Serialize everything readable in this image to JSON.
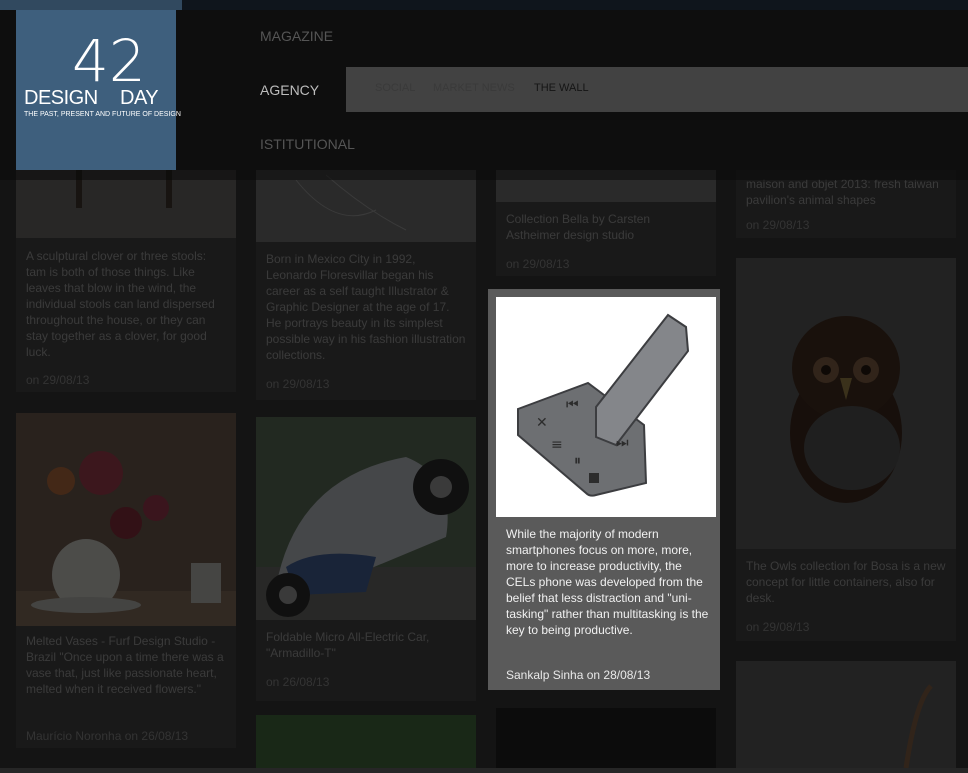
{
  "logo": {
    "word_left": "DESIGN",
    "number": "42",
    "word_right": "DAY",
    "tagline": "THE PAST, PRESENT AND FUTURE OF DESIGN"
  },
  "nav": {
    "items": [
      {
        "label": "MAGAZINE"
      },
      {
        "label": "AGENCY"
      },
      {
        "label": "ISTITUTIONAL"
      }
    ],
    "active": "AGENCY"
  },
  "subnav": {
    "links": [
      {
        "label": "SOCIAL"
      },
      {
        "label": "MARKET NEWS"
      },
      {
        "label": "THE WALL"
      }
    ],
    "active": "THE WALL"
  },
  "cards": {
    "c1": {
      "text": "A sculptural clover or three stools: tam is both of those things. Like leaves that blow in the wind, the individual stools can land dispersed throughout the house, or they can stay together as a clover, for good luck.",
      "meta": "on 29/08/13"
    },
    "c2": {
      "text": "Born in Mexico City in 1992, Leonardo Floresvillar began his career as a self taught Illustrator & Graphic Designer at the age of 17. He portrays beauty in its simplest possible way in his fashion illustration collections.",
      "meta": "on 29/08/13"
    },
    "c3": {
      "text": "Collection Bella by Carsten Astheimer design studio",
      "meta": "on 29/08/13"
    },
    "c4": {
      "text": "maison and objet 2013: fresh taiwan pavilion's animal shapes",
      "meta": "on 29/08/13"
    },
    "c5": {
      "text": "Melted Vases - Furf Design Studio - Brazil \"Once upon a time there was a vase that, just like passionate heart, melted when it received flowers.\"",
      "meta": "Maurício Noronha on 26/08/13"
    },
    "c6": {
      "text": "Foldable Micro All-Electric Car, \"Armadillo-T\"",
      "meta": "on 26/08/13"
    },
    "c7": {
      "text": "The Owls collection for Bosa is a new concept for little containers, also for desk.",
      "meta": "on 29/08/13"
    }
  },
  "highlight": {
    "text": "While the majority of modern smartphones focus on more, more, more to increase productivity, the CELs phone was developed from the belief that less distraction and \"uni-tasking\" rather than multitasking is the key to being productive.",
    "meta": "Sankalp Sinha on 28/08/13"
  }
}
